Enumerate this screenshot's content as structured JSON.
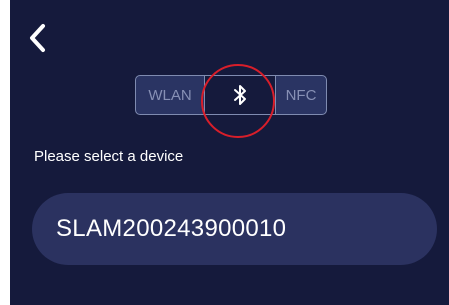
{
  "header": {
    "back_icon": "chevron-left-icon"
  },
  "connection_tabs": {
    "items": [
      {
        "label": "WLAN",
        "selected": false
      },
      {
        "icon": "bluetooth-icon",
        "selected": true
      },
      {
        "label": "NFC",
        "selected": false
      }
    ]
  },
  "hint": "Please select a device",
  "devices": [
    {
      "name": "SLAM200243900010"
    }
  ],
  "colors": {
    "background": "#151a3c",
    "card": "#2b3260",
    "tab_border": "#7f8bb0",
    "tab_text": "#8790b5",
    "highlight_circle": "#d81e2a"
  }
}
